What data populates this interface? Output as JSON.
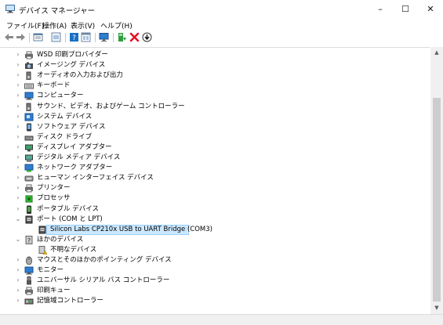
{
  "window": {
    "title": "デバイス マネージャー",
    "minimize": "–",
    "maximize": "☐",
    "close": "✕"
  },
  "menu": [
    "ファイル(F)",
    "操作(A)",
    "表示(V)",
    "ヘルプ(H)"
  ],
  "toolbar_icons": [
    "back-icon",
    "forward-icon",
    "properties-icon",
    "show-hidden-icon",
    "help-icon",
    "details-icon",
    "monitor-icon",
    "update-driver-icon",
    "uninstall-icon",
    "download-icon"
  ],
  "tree": [
    {
      "label": "WSD 印刷プロバイダー",
      "icon": "printer-icon",
      "expander": "›"
    },
    {
      "label": "イメージング デバイス",
      "icon": "camera-icon",
      "expander": "›"
    },
    {
      "label": "オーディオの入力および出力",
      "icon": "speaker-icon",
      "expander": "›"
    },
    {
      "label": "キーボード",
      "icon": "keyboard-icon",
      "expander": "›"
    },
    {
      "label": "コンピューター",
      "icon": "computer-icon",
      "expander": "›"
    },
    {
      "label": "サウンド、ビデオ、およびゲーム コントローラー",
      "icon": "speaker-icon",
      "expander": "›"
    },
    {
      "label": "システム デバイス",
      "icon": "system-icon",
      "expander": "›"
    },
    {
      "label": "ソフトウェア デバイス",
      "icon": "software-icon",
      "expander": "›"
    },
    {
      "label": "ディスク ドライブ",
      "icon": "disk-icon",
      "expander": "›"
    },
    {
      "label": "ディスプレイ アダプター",
      "icon": "display-icon",
      "expander": "›"
    },
    {
      "label": "デジタル メディア デバイス",
      "icon": "media-icon",
      "expander": "›"
    },
    {
      "label": "ネットワーク アダプター",
      "icon": "network-icon",
      "expander": "›"
    },
    {
      "label": "ヒューマン インターフェイス デバイス",
      "icon": "hid-icon",
      "expander": "›"
    },
    {
      "label": "プリンター",
      "icon": "printer-icon",
      "expander": "›"
    },
    {
      "label": "プロセッサ",
      "icon": "processor-icon",
      "expander": "›"
    },
    {
      "label": "ポータブル デバイス",
      "icon": "portable-icon",
      "expander": "›"
    },
    {
      "label": "ポート (COM と LPT)",
      "icon": "port-icon",
      "expander": "⌄"
    },
    {
      "label": "Silicon Labs CP210x USB to UART Bridge (COM3)",
      "icon": "port-icon",
      "expander": "",
      "child": true,
      "selected": true
    },
    {
      "label": "ほかのデバイス",
      "icon": "unknown-device-icon",
      "expander": "⌄"
    },
    {
      "label": "不明なデバイス",
      "icon": "warning-device-icon",
      "expander": "",
      "child": true
    },
    {
      "label": "マウスとそのほかのポインティング デバイス",
      "icon": "mouse-icon",
      "expander": "›"
    },
    {
      "label": "モニター",
      "icon": "monitor-icon",
      "expander": "›"
    },
    {
      "label": "ユニバーサル シリアル バス コントローラー",
      "icon": "usb-icon",
      "expander": "›"
    },
    {
      "label": "印刷キュー",
      "icon": "printer-icon",
      "expander": "›"
    },
    {
      "label": "記憶域コントローラー",
      "icon": "storage-icon",
      "expander": "›"
    }
  ],
  "colors": {
    "selection": "#cce8ff",
    "accent": "#1a6fc4",
    "warning": "#e8b000",
    "remove": "#e81123",
    "green": "#2e9e3e"
  },
  "scroll": {
    "up": "▲",
    "down": "▼"
  }
}
